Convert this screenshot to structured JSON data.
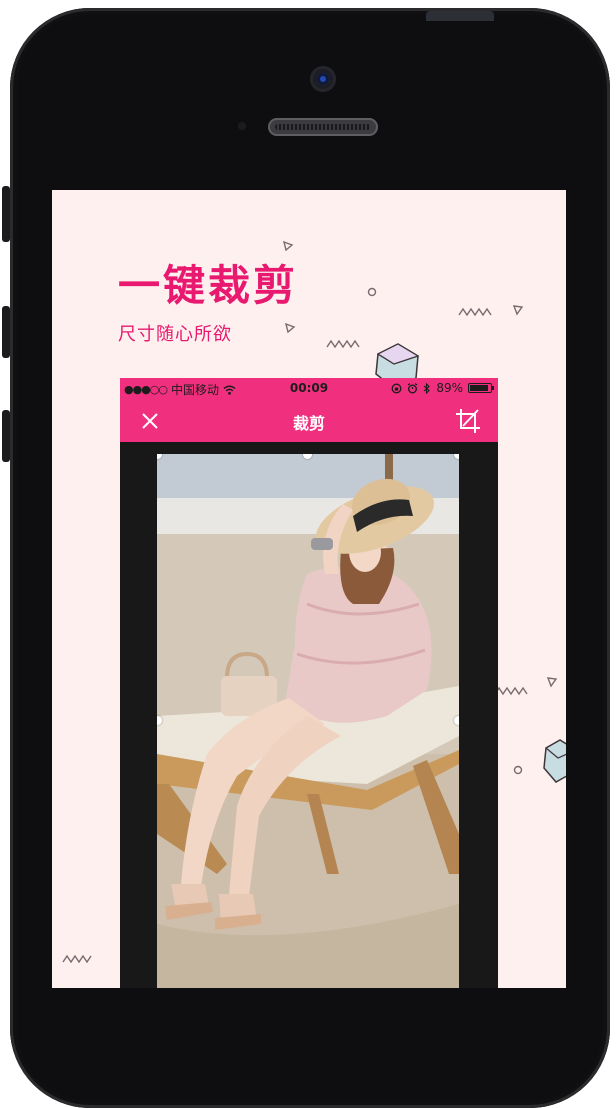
{
  "promo": {
    "headline": "一键裁剪",
    "subline": "尺寸随心所欲"
  },
  "status_bar": {
    "signal": "●●●○○",
    "carrier": "中国移动",
    "wifi_icon": "wifi-icon",
    "time": "00:09",
    "battery_percent": "89%",
    "battery_level": 0.89
  },
  "nav_bar": {
    "title": "裁剪",
    "left_icon": "close-icon",
    "right_icon": "crop-icon"
  },
  "colors": {
    "accent": "#f0307e",
    "headline": "#e8196f",
    "screen_bg": "#fdf0ef",
    "app_bg": "#181818"
  },
  "photo": {
    "subject": "woman in straw hat and pink dress seated on beach lounger"
  }
}
